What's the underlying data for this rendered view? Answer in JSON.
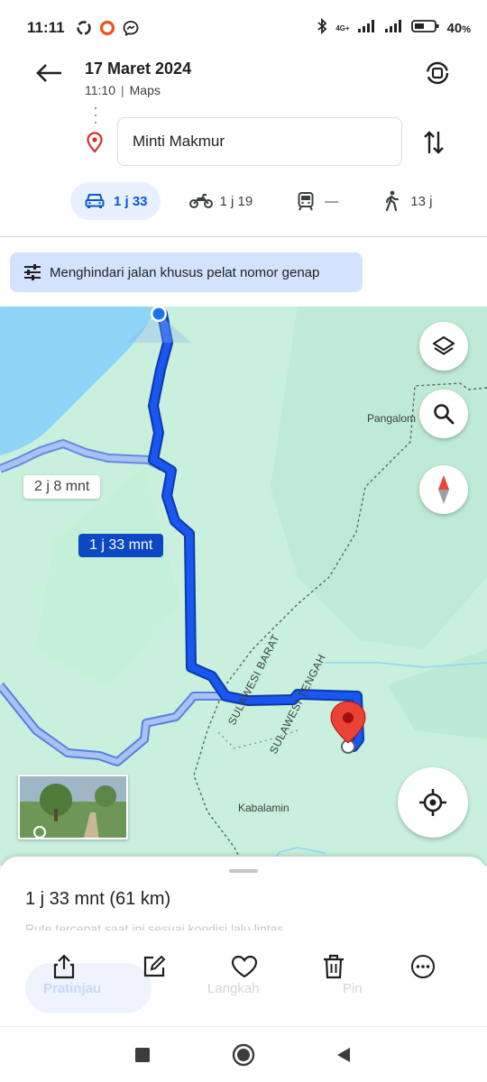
{
  "status_bar": {
    "time": "11:11",
    "battery": "40",
    "network": "4G+",
    "icons": [
      "sync-icon",
      "ring-icon",
      "messenger-icon",
      "bluetooth-icon",
      "signal-icon",
      "signal-icon",
      "battery-icon"
    ]
  },
  "header": {
    "date": "17 Maret 2024",
    "time": "11:10",
    "app": "Maps",
    "destination": "Minti Makmur"
  },
  "modes": [
    {
      "icon": "car-icon",
      "label": "1 j 33",
      "active": true
    },
    {
      "icon": "motorcycle-icon",
      "label": "1 j 19",
      "active": false
    },
    {
      "icon": "transit-icon",
      "label": "—",
      "active": false
    },
    {
      "icon": "walk-icon",
      "label": "13 j",
      "active": false
    }
  ],
  "chip": {
    "label": "Menghindari jalan khusus pelat nomor genap"
  },
  "map": {
    "labels": {
      "pangalom": "Pangalom",
      "kabalamin": "Kabalamin",
      "sulbar": "SULAWESI BARAT",
      "sulteng": "SULAWESI TENGAH"
    },
    "alt_route_time": "2 j 8 mnt",
    "main_route_time": "1 j 33 mnt",
    "colors": {
      "route": "#1a56f0",
      "alt_route": "#a9c2f6",
      "water": "#8fd5f8",
      "land": "#c8f0dc",
      "pin": "#ea4335"
    }
  },
  "sheet": {
    "summary": "1 j 33 mnt (61 km)",
    "faded_text": "Rute tercepat saat ini sesuai kondisi lalu lintas",
    "ghost_start": "Pratinjau",
    "ghost_steps": "Langkah",
    "ghost_pin": "Pin"
  }
}
